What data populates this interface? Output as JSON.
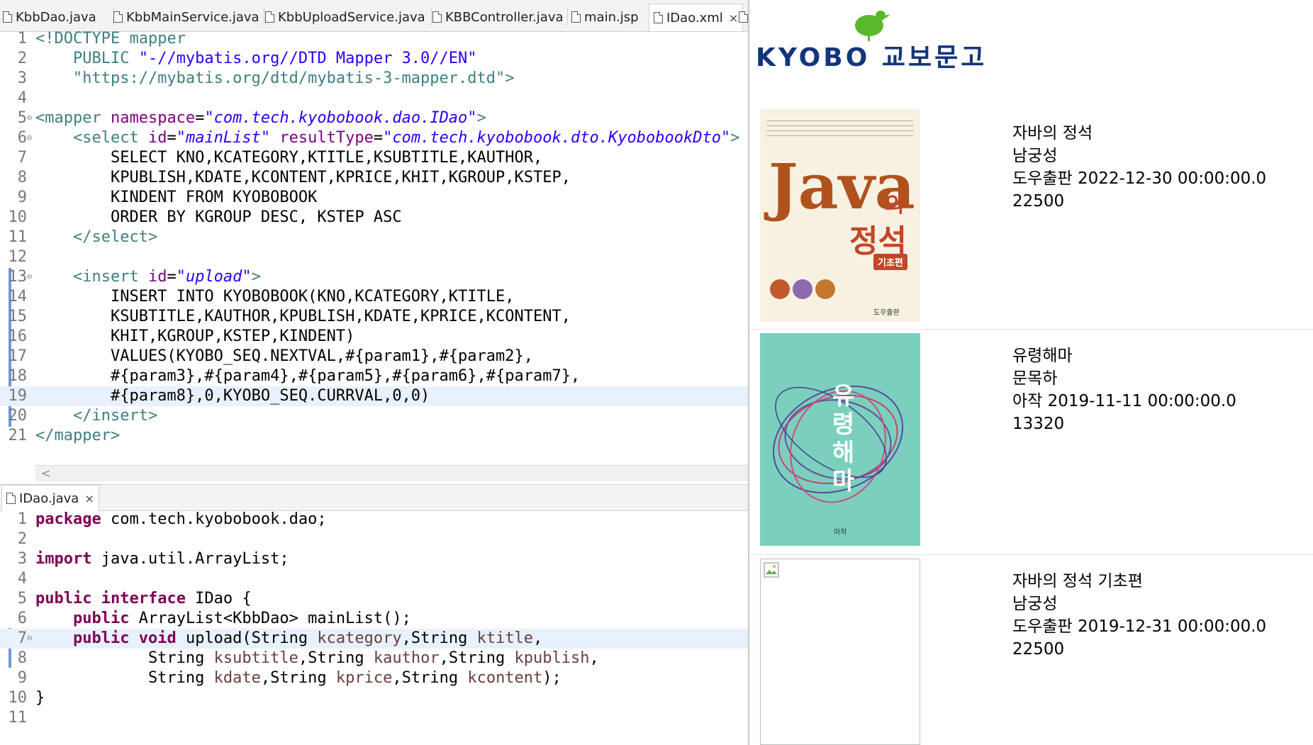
{
  "editor": {
    "tabs": [
      {
        "label": "KbbDao.java"
      },
      {
        "label": "KbbMainService.java"
      },
      {
        "label": "KbbUploadService.java"
      },
      {
        "label": "KBBController.java"
      },
      {
        "label": "main.jsp"
      },
      {
        "label": "IDao.xml",
        "active": true
      }
    ],
    "close_glyph": "×",
    "lower_tab": {
      "label": "IDao.java"
    }
  },
  "xml_lines": [
    {
      "n": "1"
    },
    {
      "n": "2"
    },
    {
      "n": "3"
    },
    {
      "n": "4"
    },
    {
      "n": "5"
    },
    {
      "n": "6"
    },
    {
      "n": "7"
    },
    {
      "n": "8"
    },
    {
      "n": "9"
    },
    {
      "n": "10"
    },
    {
      "n": "11"
    },
    {
      "n": "12"
    },
    {
      "n": "13"
    },
    {
      "n": "14"
    },
    {
      "n": "15"
    },
    {
      "n": "16"
    },
    {
      "n": "17"
    },
    {
      "n": "18"
    },
    {
      "n": "19"
    },
    {
      "n": "20"
    },
    {
      "n": "21"
    }
  ],
  "xml_code": {
    "l1_a": "<!DOCTYPE",
    "l1_b": " mapper",
    "l2_a": "    PUBLIC ",
    "l2_b": "\"-//mybatis.org//DTD Mapper 3.0//EN\"",
    "l3": "    \"https://mybatis.org/dtd/mybatis-3-mapper.dtd\">",
    "l5_tag": "<mapper ",
    "l5_attr": "namespace",
    "l5_eq": "=",
    "l5_val": "\"com.tech.kyobobook.dao.IDao\"",
    "l5_end": ">",
    "l6_tag": "    <select ",
    "l6_attr1": "id",
    "l6_val1": "\"mainList\"",
    "l6_attr2": " resultType",
    "l6_val2": "\"com.tech.kyobobook.dto.KyobobookDto\"",
    "l6_end": ">",
    "l7": "        SELECT KNO,KCATEGORY,KTITLE,KSUBTITLE,KAUTHOR,",
    "l8": "        KPUBLISH,KDATE,KCONTENT,KPRICE,KHIT,KGROUP,KSTEP,",
    "l9": "        KINDENT FROM KYOBOBOOK",
    "l10": "        ORDER BY KGROUP DESC, KSTEP ASC",
    "l11": "    </select>",
    "l13_tag": "    <insert ",
    "l13_attr": "id",
    "l13_val": "\"upload\"",
    "l13_end": ">",
    "l14": "        INSERT INTO KYOBOBOOK(KNO,KCATEGORY,KTITLE,",
    "l15": "        KSUBTITLE,KAUTHOR,KPUBLISH,KDATE,KPRICE,KCONTENT,",
    "l16": "        KHIT,KGROUP,KSTEP,KINDENT)",
    "l17": "        VALUES(KYOBO_SEQ.NEXTVAL,#{param1},#{param2},",
    "l18": "        #{param3},#{param4},#{param5},#{param6},#{param7},",
    "l19": "        #{param8},0,KYOBO_SEQ.CURRVAL,0,0)",
    "l20": "    </insert>",
    "l21": "</mapper>"
  },
  "java_lines": [
    {
      "n": "1"
    },
    {
      "n": "2"
    },
    {
      "n": "3"
    },
    {
      "n": "4"
    },
    {
      "n": "5"
    },
    {
      "n": "6"
    },
    {
      "n": "7"
    },
    {
      "n": "8"
    },
    {
      "n": "9"
    },
    {
      "n": "10"
    },
    {
      "n": "11"
    }
  ],
  "java_code": {
    "j1_kw": "package",
    "j1_rest": " com.tech.kyobobook.dao;",
    "j3_kw": "import",
    "j3_rest": " java.util.ArrayList;",
    "j5_kw1": "public",
    "j5_kw2": " interface",
    "j5_rest": " IDao {",
    "j6_ind": "    ",
    "j6_kw": "public",
    "j6_rest": " ArrayList<KbbDao> mainList();",
    "j7_ind": "    ",
    "j7_kw1": "public",
    "j7_kw2": " void",
    "j7_a": " upload(String ",
    "j7_p1": "kcategory",
    "j7_b": ",String ",
    "j7_p2": "ktitle",
    "j7_c": ",",
    "j8_a": "            String ",
    "j8_p1": "ksubtitle",
    "j8_b": ",String ",
    "j8_p2": "kauthor",
    "j8_c": ",String ",
    "j8_p3": "kpublish",
    "j8_d": ",",
    "j9_a": "            String ",
    "j9_p1": "kdate",
    "j9_b": ",String ",
    "j9_p2": "kprice",
    "j9_c": ",String ",
    "j9_p3": "kcontent",
    "j9_d": ");",
    "j10": "}"
  },
  "browser": {
    "logo": {
      "text": "KYOBO 교보문고",
      "color": "#14357a",
      "bird_color": "#5ab82d"
    },
    "books": [
      {
        "title": "자바의 정석",
        "author": "남궁성",
        "publisher_date": "도우출판 2022-12-30 00:00:00.0",
        "price": "22500",
        "cover": {
          "title_en": "Java",
          "title_ko_suffix": "의",
          "title_ko": "정석",
          "edition": "기초편",
          "publisher": "도우출판"
        }
      },
      {
        "title": "유령해마",
        "author": "문목하",
        "publisher_date": "아작 2019-11-11 00:00:00.0",
        "price": "13320",
        "cover": {
          "title_ko": "유령해마",
          "publisher": "아작"
        }
      },
      {
        "title": "자바의 정석 기초편",
        "author": "남궁성",
        "publisher_date": "도우출판 2019-12-31 00:00:00.0",
        "price": "22500"
      }
    ]
  }
}
